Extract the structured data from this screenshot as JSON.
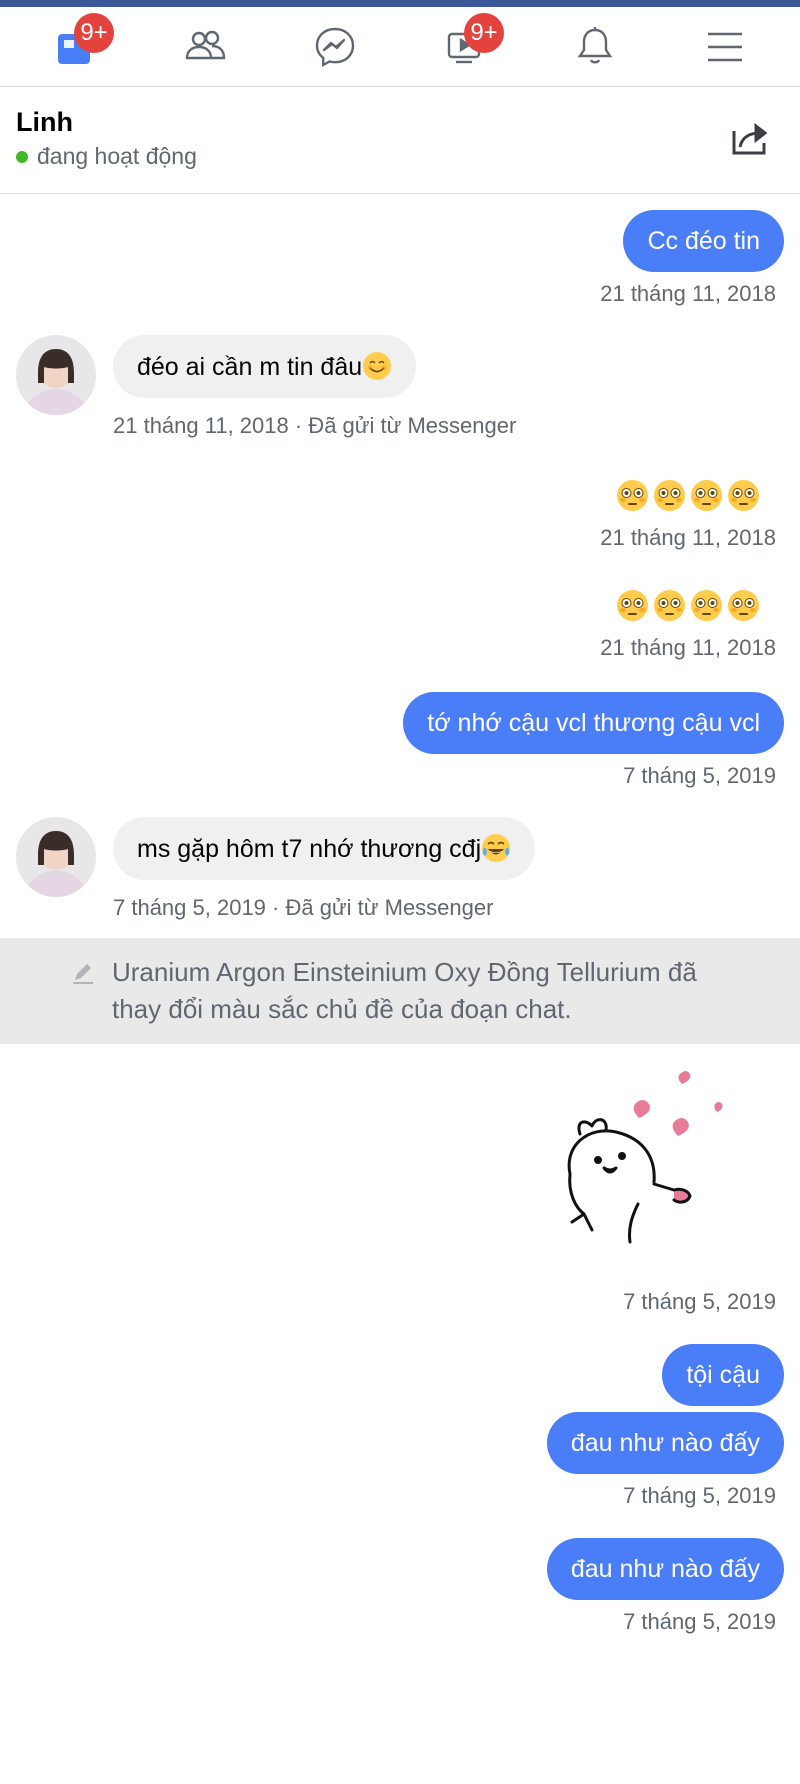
{
  "navbar": {
    "items": [
      {
        "name": "news-feed",
        "badge": "9+"
      },
      {
        "name": "friends",
        "badge": ""
      },
      {
        "name": "messenger",
        "badge": ""
      },
      {
        "name": "watch",
        "badge": "9+"
      },
      {
        "name": "notifications",
        "badge": ""
      },
      {
        "name": "menu",
        "badge": ""
      }
    ]
  },
  "chat_header": {
    "name": "Linh",
    "status": "đang hoạt động"
  },
  "colors": {
    "accent": "#4a7df8",
    "brand_stripe": "#3b5998",
    "badge": "#e4433d",
    "online": "#42b72a",
    "incoming_bubble": "#f0f0f0",
    "event_bg": "#e9e9e9"
  },
  "messages": [
    {
      "type": "out",
      "text": "Cc đéo tin",
      "time": "21 tháng 11, 2018"
    },
    {
      "type": "in",
      "text": "đéo ai cần m tin đâu",
      "emoji": "smiling-face",
      "meta": "21 tháng 11, 2018 · Đã gửi từ Messenger"
    },
    {
      "type": "out-emoji",
      "emoji": "flushed-face ×4",
      "time": "21 tháng 11, 2018"
    },
    {
      "type": "out-emoji",
      "emoji": "flushed-face ×4",
      "time": "21 tháng 11, 2018"
    },
    {
      "type": "out",
      "text": "tớ nhớ cậu vcl thương cậu vcl",
      "time": "7 tháng 5, 2019"
    },
    {
      "type": "in",
      "text": "ms gặp hôm t7 nhớ thương cđj",
      "emoji": "tears-of-joy-face",
      "meta": "7 tháng 5, 2019 · Đã gửi từ Messenger"
    },
    {
      "type": "event",
      "text": "Uranium Argon Einsteinium Oxy Đồng Tellurium đã thay đổi màu sắc chủ đề của đoạn chat."
    },
    {
      "type": "out-sticker",
      "sticker": "rabbit-hearts-sticker",
      "time": "7 tháng 5, 2019"
    },
    {
      "type": "out",
      "text": "tội cậu"
    },
    {
      "type": "out",
      "text": "đau như nào đấy",
      "time": "7 tháng 5, 2019"
    },
    {
      "type": "out",
      "text": "đau như nào đấy",
      "time": "7 tháng 5, 2019"
    }
  ]
}
